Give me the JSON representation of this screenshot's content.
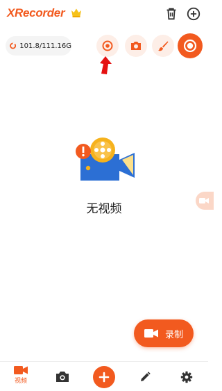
{
  "header": {
    "brand": "XRecorder",
    "crown_icon": "crown-icon",
    "trash_icon": "trash-icon",
    "add_icon": "add-circle-icon"
  },
  "toolbar": {
    "storage_text": "101.8/111.16G",
    "record_icon": "record-icon",
    "screenshot_icon": "camera-icon",
    "brush_icon": "brush-icon",
    "main_icon": "record-target-icon"
  },
  "annotation": {
    "arrow_icon": "red-arrow-icon"
  },
  "empty_state": {
    "text": "无视频",
    "illustration_icon": "video-camera-warning-icon"
  },
  "fab": {
    "label": "录制",
    "icon": "video-camera-icon"
  },
  "bottom_nav": {
    "video_label": "视频",
    "items": [
      "video-icon",
      "camera-icon",
      "add-icon",
      "pencil-icon",
      "gear-icon"
    ]
  },
  "colors": {
    "accent": "#f25a1f",
    "accent_light": "#fdeee7",
    "illustration_blue": "#2c6fd4",
    "illustration_yellow": "#f6b21c",
    "arrow_red": "#e51010"
  }
}
